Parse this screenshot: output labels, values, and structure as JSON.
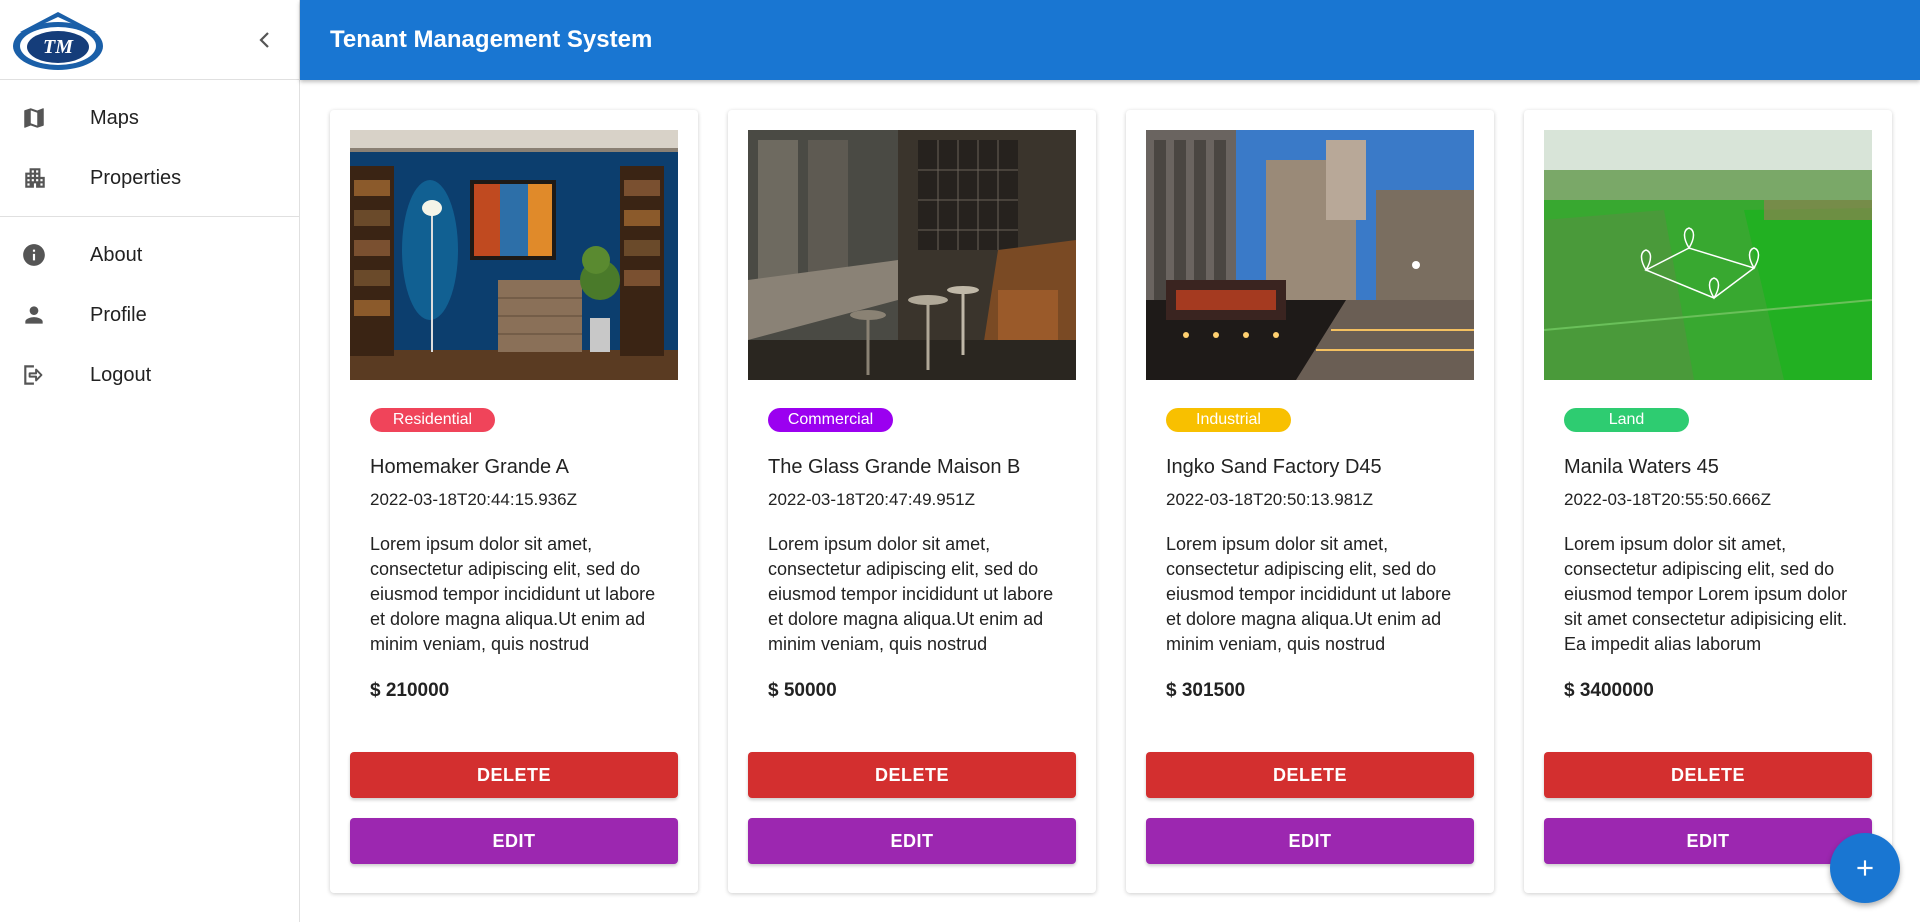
{
  "app": {
    "title": "Tenant Management System"
  },
  "sidebar": {
    "logo_text": "TM",
    "primary_items": [
      {
        "label": "Maps",
        "icon": "map-icon"
      },
      {
        "label": "Properties",
        "icon": "properties-icon"
      }
    ],
    "secondary_items": [
      {
        "label": "About",
        "icon": "info-icon"
      },
      {
        "label": "Profile",
        "icon": "person-icon"
      },
      {
        "label": "Logout",
        "icon": "logout-icon"
      }
    ]
  },
  "properties": [
    {
      "type": "Residential",
      "type_color": "#f0445a",
      "title": "Homemaker Grande A",
      "date": "2022-03-18T20:44:15.936Z",
      "description": "Lorem ipsum dolor sit amet, consectetur adipiscing elit, sed do eiusmod tempor incididunt ut labore et dolore magna aliqua.Ut enim ad minim veniam, quis nostrud",
      "price": "$ 210000",
      "delete_label": "DELETE",
      "edit_label": "EDIT"
    },
    {
      "type": "Commercial",
      "type_color": "#9b00f0",
      "title": "The Glass Grande Maison B",
      "date": "2022-03-18T20:47:49.951Z",
      "description": "Lorem ipsum dolor sit amet, consectetur adipiscing elit, sed do eiusmod tempor incididunt ut labore et dolore magna aliqua.Ut enim ad minim veniam, quis nostrud",
      "price": "$ 50000",
      "delete_label": "DELETE",
      "edit_label": "EDIT"
    },
    {
      "type": "Industrial",
      "type_color": "#f8c000",
      "title": "Ingko Sand Factory D45",
      "date": "2022-03-18T20:50:13.981Z",
      "description": "Lorem ipsum dolor sit amet, consectetur adipiscing elit, sed do eiusmod tempor incididunt ut labore et dolore magna aliqua.Ut enim ad minim veniam, quis nostrud",
      "price": "$ 301500",
      "delete_label": "DELETE",
      "edit_label": "EDIT"
    },
    {
      "type": "Land",
      "type_color": "#2ecc71",
      "title": "Manila Waters 45",
      "date": "2022-03-18T20:55:50.666Z",
      "description": "Lorem ipsum dolor sit amet, consectetur adipiscing elit, sed do eiusmod tempor Lorem ipsum dolor sit amet consectetur adipisicing elit. Ea impedit alias laborum",
      "price": "$ 3400000",
      "delete_label": "DELETE",
      "edit_label": "EDIT"
    }
  ],
  "fab": {
    "icon": "add-icon"
  },
  "colors": {
    "header": "#1976d2",
    "delete": "#d32f2f",
    "edit": "#9c27b0",
    "fab": "#1976d2"
  }
}
